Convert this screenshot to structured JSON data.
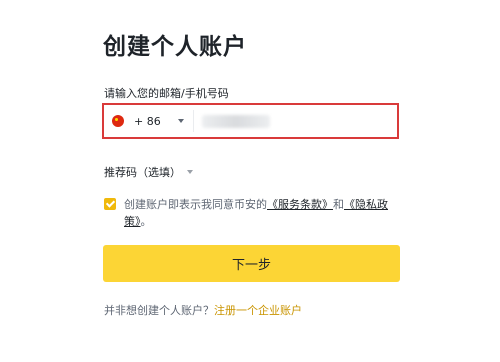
{
  "page": {
    "title": "创建个人账户"
  },
  "phone": {
    "label": "请输入您的邮箱/手机号码",
    "country_flag": "china-flag-icon",
    "dial_code": "+ 86",
    "value": ""
  },
  "referral": {
    "label": "推荐码（选填）"
  },
  "agreement": {
    "checked": true,
    "prefix": "创建账户即表示我同意币安的",
    "terms_link": "《服务条款》",
    "conjunction": "和",
    "privacy_link": "《隐私政策》",
    "suffix": "。"
  },
  "next_button": {
    "label": "下一步"
  },
  "footer": {
    "question": "并非想创建个人账户？",
    "link": "注册一个企业账户"
  },
  "colors": {
    "accent": "#fcd535",
    "checkbox": "#f0b90b",
    "link": "#c99400",
    "highlight_border": "#d93a3a",
    "text": "#1e2329"
  }
}
